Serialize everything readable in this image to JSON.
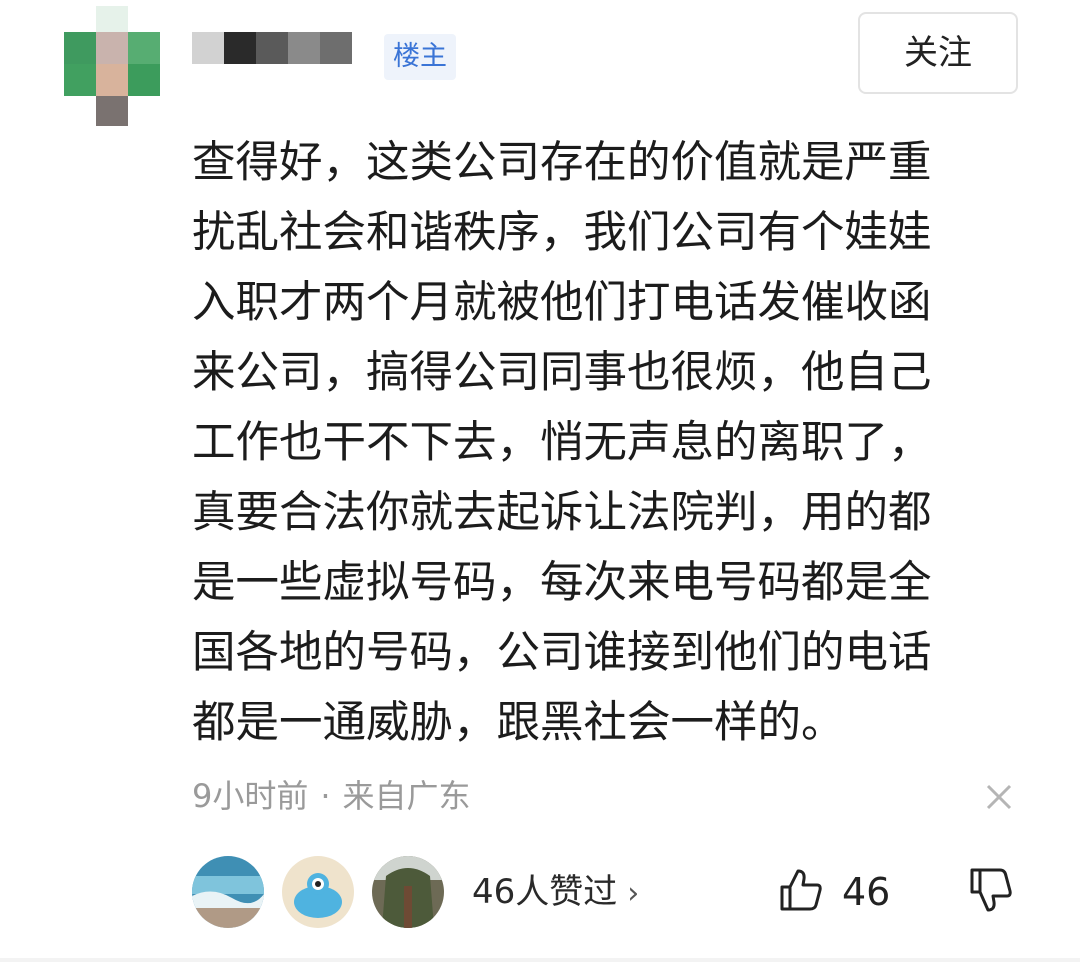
{
  "comment": {
    "owner_badge": "楼主",
    "follow_label": "关注",
    "text": "查得好，这类公司存在的价值就是严重\n扰乱社会和谐秩序，我们公司有个娃娃\n入职才两个月就被他们打电话发催收函\n来公司，搞得公司同事也很烦，他自己\n工作也干不下去，悄无声息的离职了，\n真要合法你就去起诉让法院判，用的都\n是一些虚拟号码，每次来电号码都是全\n国各地的号码，公司谁接到他们的电话\n都是一通威胁，跟黑社会一样的。",
    "time": "9小时前",
    "separator": "·",
    "location": "来自广东"
  },
  "reactions": {
    "likers_text": "46人赞过",
    "chevron": "›",
    "like_count": "46"
  },
  "icons": {
    "dismiss": "close-icon",
    "like": "thumbs-up-icon",
    "dislike": "thumbs-down-icon"
  },
  "colors": {
    "badge_text": "#3a74d6",
    "badge_bg": "#eef3fb",
    "meta_text": "#9a9a9a"
  }
}
